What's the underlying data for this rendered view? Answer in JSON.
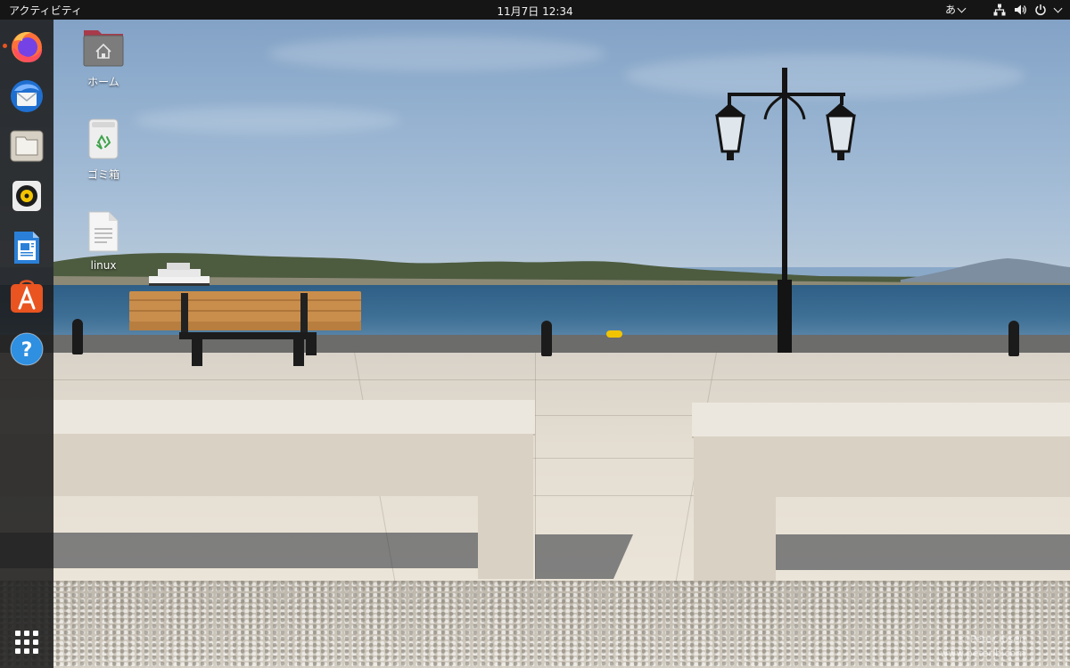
{
  "topbar": {
    "activities": "アクティビティ",
    "clock": "11月7日  12:34",
    "input_method": "あ"
  },
  "dock": {
    "apps": [
      {
        "name": "Firefox",
        "icon": "firefox-icon",
        "running": true
      },
      {
        "name": "Thunderbird",
        "icon": "thunderbird-icon",
        "running": false
      },
      {
        "name": "Files",
        "icon": "files-icon",
        "running": false
      },
      {
        "name": "Rhythmbox",
        "icon": "rhythmbox-icon",
        "running": false
      },
      {
        "name": "LibreOffice Writer",
        "icon": "writer-icon",
        "running": false
      },
      {
        "name": "Ubuntu Software",
        "icon": "software-icon",
        "running": false
      },
      {
        "name": "Help",
        "icon": "help-icon",
        "running": false
      }
    ],
    "show_apps_icon": "grid-icon"
  },
  "desktop": {
    "icons": [
      {
        "label": "ホーム",
        "icon": "home-folder-icon"
      },
      {
        "label": "ゴミ箱",
        "icon": "trash-icon"
      },
      {
        "label": "linux",
        "icon": "text-file-icon"
      }
    ]
  },
  "wallpaper": {
    "watermark_line1": "© Peter Ibsen",
    "watermark_line2": "www.peterib.com"
  },
  "colors": {
    "topbar": "#151515",
    "dock": "#1c1c1c",
    "accent": "#e95420"
  }
}
